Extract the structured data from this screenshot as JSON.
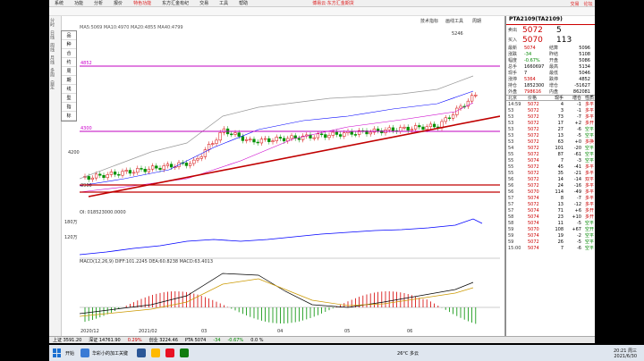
{
  "menu": {
    "items": [
      "系统",
      "功能",
      "分析",
      "报价",
      "特色功能",
      "东方汇金有纪",
      "交易",
      "工具",
      "帮助"
    ],
    "title": "博易云·东方汇金期货",
    "right": [
      "交易",
      "论坛"
    ]
  },
  "chart": {
    "symbol": "PTA2109(TA2109)",
    "ma_legend": "MA5:5069  MA10:4970  MA20:4855  MA40:4799",
    "header_right": [
      "技术指标",
      "画线工具",
      "周期"
    ],
    "price_labels": [
      "4852",
      "4300",
      "4200",
      "3900",
      "3800"
    ],
    "level_labels": [
      "4852",
      "4300",
      "3900"
    ],
    "high_label": "5246",
    "vol_head": "OI: 018523000.0000",
    "vol_labels": [
      "180万",
      "120万"
    ],
    "macd_head": "MACD(12,26,9)  DIFF:101.2245  DEA:60.8238  MACD:63.4013",
    "macd_labels": [
      "150",
      "100",
      "50",
      "0",
      "-50"
    ],
    "dates": [
      "2020/12",
      "2021/02",
      "03",
      "04",
      "05",
      "06"
    ],
    "left_tabs": [
      "分时",
      "日线",
      "周线",
      "月线",
      "多周",
      "自定"
    ],
    "small_menu": [
      "品",
      "种",
      "合",
      "约",
      "周",
      "期",
      "线",
      "型",
      "指",
      "标"
    ]
  },
  "quote": {
    "title": "PTA2109(TA2109)",
    "ask": {
      "label": "卖出",
      "price": "5072",
      "qty": "5"
    },
    "bid": {
      "label": "买入",
      "price": "5070",
      "qty": "113"
    },
    "rows": [
      {
        "l1": "最新",
        "v1": "5074",
        "c1": "red",
        "l2": "结算",
        "v2": "5096"
      },
      {
        "l1": "涨跌",
        "v1": "-34",
        "c1": "green",
        "l2": "昨结",
        "v2": "5108"
      },
      {
        "l1": "幅度",
        "v1": "-0.67%",
        "c1": "green",
        "l2": "开盘",
        "v2": "5086"
      },
      {
        "l1": "总手",
        "v1": "1660697",
        "c1": "",
        "l2": "最高",
        "v2": "5134"
      },
      {
        "l1": "现手",
        "v1": "7",
        "c1": "",
        "l2": "最低",
        "v2": "5046"
      },
      {
        "l1": "涨停",
        "v1": "5364",
        "c1": "red",
        "l2": "跌停",
        "v2": "4852"
      },
      {
        "l1": "持仓",
        "v1": "1852300",
        "c1": "",
        "l2": "增仓",
        "v2": "-51627"
      },
      {
        "l1": "外盘",
        "v1": "798616",
        "c1": "red",
        "l2": "内盘",
        "v2": "862081"
      }
    ],
    "trade_head": [
      "北京",
      "价格",
      "现手",
      "增仓",
      "性质"
    ],
    "trades": [
      {
        "t": "14:59",
        "p": "5072",
        "q": "4",
        "d": "-1",
        "k": "多平",
        "c": "red"
      },
      {
        "t": "53",
        "p": "5072",
        "q": "3",
        "d": "-1",
        "k": "多平",
        "c": "red"
      },
      {
        "t": "53",
        "p": "5072",
        "q": "73",
        "d": "-7",
        "k": "多平",
        "c": "red"
      },
      {
        "t": "53",
        "p": "5072",
        "q": "17",
        "d": "+2",
        "k": "多开",
        "c": "red"
      },
      {
        "t": "53",
        "p": "5072",
        "q": "27",
        "d": "-6",
        "k": "空平",
        "c": "green"
      },
      {
        "t": "53",
        "p": "5072",
        "q": "13",
        "d": "-5",
        "k": "空平",
        "c": "green"
      },
      {
        "t": "53",
        "p": "5072",
        "q": "63",
        "d": "+0",
        "k": "多换",
        "c": "red"
      },
      {
        "t": "54",
        "p": "5072",
        "q": "101",
        "d": "-20",
        "k": "空平",
        "c": "green"
      },
      {
        "t": "55",
        "p": "5072",
        "q": "87",
        "d": "-61",
        "k": "空平",
        "c": "green"
      },
      {
        "t": "55",
        "p": "5074",
        "q": "7",
        "d": "-3",
        "k": "空平",
        "c": "green"
      },
      {
        "t": "55",
        "p": "5072",
        "q": "45",
        "d": "-41",
        "k": "多平",
        "c": "red"
      },
      {
        "t": "55",
        "p": "5072",
        "q": "35",
        "d": "-21",
        "k": "多平",
        "c": "red"
      },
      {
        "t": "56",
        "p": "5072",
        "q": "14",
        "d": "-14",
        "k": "双平",
        "c": "red"
      },
      {
        "t": "56",
        "p": "5072",
        "q": "24",
        "d": "-16",
        "k": "多平",
        "c": "red"
      },
      {
        "t": "56",
        "p": "5070",
        "q": "114",
        "d": "-49",
        "k": "多平",
        "c": "red"
      },
      {
        "t": "57",
        "p": "5074",
        "q": "8",
        "d": "-7",
        "k": "多平",
        "c": "red"
      },
      {
        "t": "57",
        "p": "5072",
        "q": "13",
        "d": "-12",
        "k": "多平",
        "c": "red"
      },
      {
        "t": "57",
        "p": "5074",
        "q": "71",
        "d": "+6",
        "k": "多开",
        "c": "red"
      },
      {
        "t": "58",
        "p": "5074",
        "q": "23",
        "d": "+10",
        "k": "多开",
        "c": "red"
      },
      {
        "t": "58",
        "p": "5074",
        "q": "11",
        "d": "-5",
        "k": "空平",
        "c": "green"
      },
      {
        "t": "59",
        "p": "5070",
        "q": "108",
        "d": "+67",
        "k": "空开",
        "c": "green"
      },
      {
        "t": "59",
        "p": "5074",
        "q": "19",
        "d": "-2",
        "k": "空平",
        "c": "green"
      },
      {
        "t": "59",
        "p": "5072",
        "q": "26",
        "d": "-5",
        "k": "空平",
        "c": "green"
      },
      {
        "t": "15:00",
        "p": "5074",
        "q": "7",
        "d": "-6",
        "k": "空平",
        "c": "green"
      }
    ]
  },
  "status": [
    "上证 3591.20",
    "深证 14761.90",
    "0.29%",
    "创业 3224.46",
    "PTA 5074",
    "-34",
    "-0.67%",
    "0.0 %"
  ],
  "taskbar": {
    "items": [
      "开始",
      "华彩小的加工关键"
    ],
    "weather": "26°C 多云",
    "time": "20:21 周三",
    "date": "2021/6/30"
  },
  "colors": {
    "up": "#d40000",
    "down": "#009000",
    "accent": "#c00000",
    "bg": "#ffffff",
    "level": "#c000c0",
    "trend": "#c00000"
  }
}
